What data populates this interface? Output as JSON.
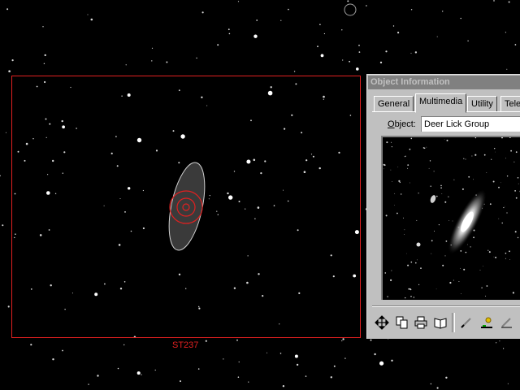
{
  "sky_view": {
    "fov_label": "ST237",
    "colors": {
      "fov_frame": "#e02020",
      "target_marker": "#e02020",
      "galaxy_fill": "#3a3a3a"
    }
  },
  "info_window": {
    "title": "Object Information",
    "tabs": [
      {
        "label": "General",
        "active": false
      },
      {
        "label": "Multimedia",
        "active": true
      },
      {
        "label": "Utility",
        "active": false
      },
      {
        "label": "Tele",
        "active": false
      }
    ],
    "object": {
      "label_accel": "O",
      "label_rest": "bject:",
      "value": "Deer Lick Group"
    },
    "image_description_icon": "galaxy-photo",
    "toolbar": [
      "move-icon",
      "copy-icon",
      "print-icon",
      "book-icon",
      "edit-icon",
      "filter-icon",
      "arrow-icon"
    ]
  }
}
